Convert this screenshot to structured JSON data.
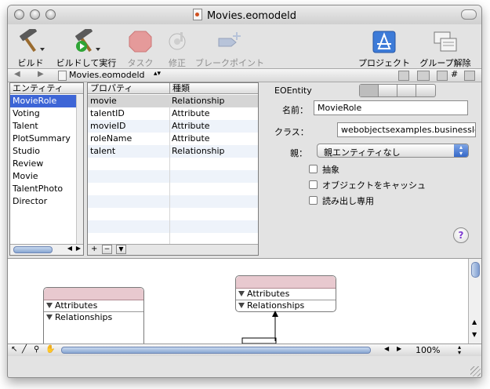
{
  "window": {
    "title": "Movies.eomodeld"
  },
  "toolbar": {
    "items": [
      {
        "label": "ビルド"
      },
      {
        "label": "ビルドして実行"
      },
      {
        "label": "タスク"
      },
      {
        "label": "修正"
      },
      {
        "label": "ブレークポイント"
      },
      {
        "label": "プロジェクト"
      },
      {
        "label": "グループ解除"
      }
    ]
  },
  "pathbar": {
    "file": "Movies.eomodeld"
  },
  "entities": {
    "header": "エンティティ",
    "items": [
      "MovieRole",
      "Voting",
      "Talent",
      "PlotSummary",
      "Studio",
      "Review",
      "Movie",
      "TalentPhoto",
      "Director"
    ]
  },
  "properties": {
    "col_property": "プロパティ",
    "col_type": "種類",
    "rows": [
      {
        "name": "movie",
        "type": "Relationship"
      },
      {
        "name": "talentID",
        "type": "Attribute"
      },
      {
        "name": "movieID",
        "type": "Attribute"
      },
      {
        "name": "roleName",
        "type": "Attribute"
      },
      {
        "name": "talent",
        "type": "Relationship"
      }
    ]
  },
  "inspector": {
    "title": "EOEntity",
    "name_label": "名前：",
    "name_value": "MovieRole",
    "class_label": "クラス：",
    "class_value": "webobjectsexamples.businesslogic.m",
    "parent_label": "親：",
    "parent_value": "親エンティティなし",
    "abstract_label": "抽象",
    "cache_label": "オブジェクトをキャッシュ",
    "readonly_label": "読み出し専用",
    "help": "?"
  },
  "diagram": {
    "box1": {
      "attributes": "Attributes",
      "relationships": "Relationships"
    },
    "box2": {
      "attributes": "Attributes",
      "relationships": "Relationships"
    },
    "zoom": "100%"
  },
  "colors": {
    "selection": "#3d65d6",
    "entity_header": "#e8c9cf",
    "help": "#7f3bd1"
  }
}
